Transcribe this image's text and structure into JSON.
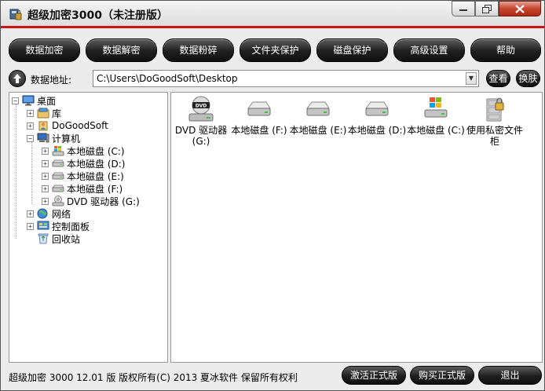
{
  "window": {
    "title": "超级加密3000（未注册版）",
    "accent_color": "#c8141a"
  },
  "toolbar": {
    "buttons": [
      "数据加密",
      "数据解密",
      "数据粉碎",
      "文件夹保护",
      "磁盘保护",
      "高级设置",
      "帮助"
    ]
  },
  "address": {
    "label": "数据地址:",
    "value": "C:\\Users\\DoGoodSoft\\Desktop",
    "view_label": "查看",
    "skin_label": "换肤"
  },
  "tree": {
    "root": "桌面",
    "items": [
      {
        "label": "库",
        "icon": "library-icon"
      },
      {
        "label": "DoGoodSoft",
        "icon": "user-folder-icon"
      },
      {
        "label": "计算机",
        "icon": "computer-icon"
      },
      {
        "label": "本地磁盘 (C:)",
        "icon": "system-drive-icon"
      },
      {
        "label": "本地磁盘 (D:)",
        "icon": "drive-icon"
      },
      {
        "label": "本地磁盘 (E:)",
        "icon": "drive-icon"
      },
      {
        "label": "本地磁盘 (F:)",
        "icon": "drive-icon"
      },
      {
        "label": "DVD 驱动器 (G:)",
        "icon": "dvd-drive-icon"
      },
      {
        "label": "网络",
        "icon": "network-icon"
      },
      {
        "label": "控制面板",
        "icon": "control-panel-icon"
      },
      {
        "label": "回收站",
        "icon": "recycle-bin-icon"
      }
    ]
  },
  "files": [
    {
      "label": "DVD 驱动器 (G:)",
      "icon": "dvd-drive-icon"
    },
    {
      "label": "本地磁盘 (F:)",
      "icon": "drive-icon"
    },
    {
      "label": "本地磁盘 (E:)",
      "icon": "drive-icon"
    },
    {
      "label": "本地磁盘 (D:)",
      "icon": "drive-icon"
    },
    {
      "label": "本地磁盘 (C:)",
      "icon": "system-drive-icon"
    },
    {
      "label": "使用私密文件柜",
      "icon": "private-cabinet-icon"
    }
  ],
  "status": {
    "text": "超级加密 3000   12.01 版    版权所有(C)  2013 夏冰软件   保留所有权利",
    "activate_label": "激活正式版",
    "buy_label": "购买正式版",
    "exit_label": "退出"
  }
}
